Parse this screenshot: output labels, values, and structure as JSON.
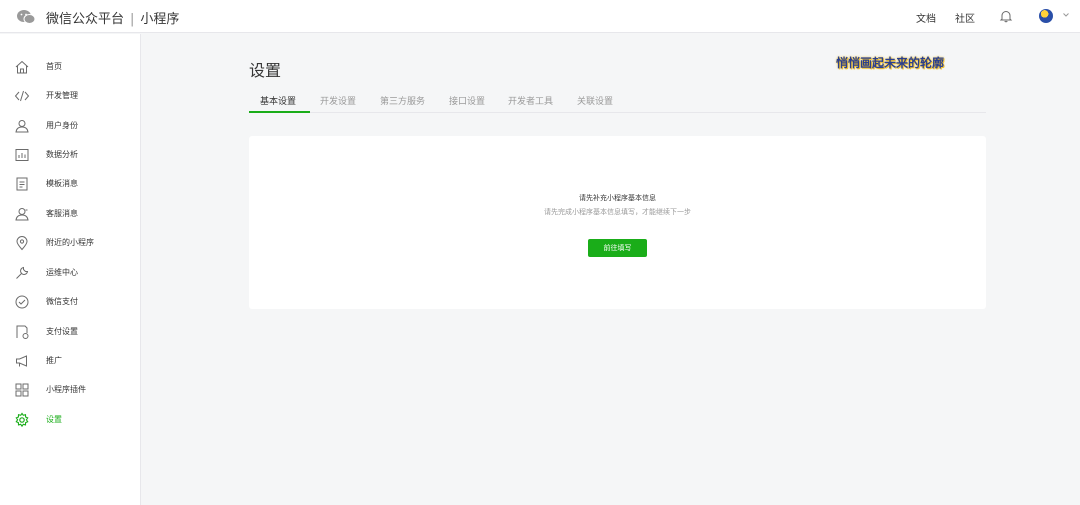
{
  "header": {
    "brand": "微信公众平台",
    "separator": "|",
    "product": "小程序",
    "docs_link": "文档",
    "community_link": "社区"
  },
  "sidebar": {
    "items": [
      {
        "label": "首页",
        "icon": "home-icon"
      },
      {
        "label": "开发管理",
        "icon": "code-icon"
      },
      {
        "label": "用户身份",
        "icon": "user-icon"
      },
      {
        "label": "数据分析",
        "icon": "chart-icon"
      },
      {
        "label": "模板消息",
        "icon": "document-icon"
      },
      {
        "label": "客服消息",
        "icon": "customer-service-icon"
      },
      {
        "label": "附近的小程序",
        "icon": "location-pin-icon"
      },
      {
        "label": "运维中心",
        "icon": "wrench-icon"
      },
      {
        "label": "微信支付",
        "icon": "wechat-pay-icon"
      },
      {
        "label": "支付设置",
        "icon": "payment-settings-icon"
      },
      {
        "label": "推广",
        "icon": "megaphone-icon"
      },
      {
        "label": "小程序插件",
        "icon": "plugin-icon"
      },
      {
        "label": "设置",
        "icon": "gear-icon",
        "active": true
      }
    ]
  },
  "main": {
    "title": "设置",
    "watermark": "悄悄画起未来的轮廓",
    "tabs": [
      {
        "label": "基本设置",
        "active": true
      },
      {
        "label": "开发设置"
      },
      {
        "label": "第三方服务"
      },
      {
        "label": "接口设置"
      },
      {
        "label": "开发者工具"
      },
      {
        "label": "关联设置"
      }
    ],
    "notice": {
      "title": "请先补充小程序基本信息",
      "subtitle": "请先完成小程序基本信息填写，才能继续下一步",
      "button": "前往填写"
    }
  },
  "colors": {
    "accent": "#1aad19",
    "text": "#353535",
    "muted": "#9a9a9a",
    "background": "#f5f6f7"
  }
}
